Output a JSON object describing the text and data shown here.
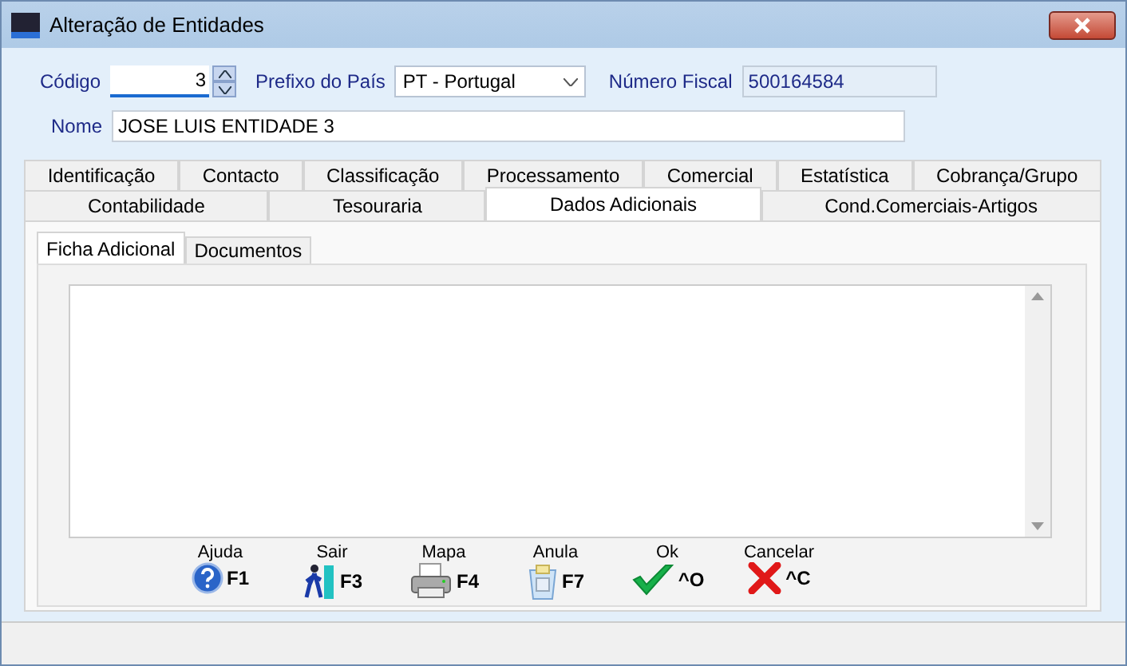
{
  "window": {
    "title": "Alteração de Entidades"
  },
  "form": {
    "codigo": {
      "label": "Código",
      "value": "3"
    },
    "prefixo": {
      "label": "Prefixo do País",
      "value": "PT - Portugal"
    },
    "nif": {
      "label": "Número Fiscal",
      "value": "500164584"
    },
    "nome": {
      "label": "Nome",
      "value": "JOSE LUIS ENTIDADE 3"
    }
  },
  "tab_rows": [
    [
      {
        "label": "Identificação",
        "selected": false
      },
      {
        "label": "Contacto",
        "selected": false
      },
      {
        "label": "Classificação",
        "selected": false
      },
      {
        "label": "Processamento",
        "selected": false
      },
      {
        "label": "Comercial",
        "selected": false
      },
      {
        "label": "Estatística",
        "selected": false
      },
      {
        "label": "Cobrança/Grupo",
        "selected": false
      }
    ],
    [
      {
        "label": "Contabilidade",
        "selected": false
      },
      {
        "label": "Tesouraria",
        "selected": false
      },
      {
        "label": "Dados Adicionais",
        "selected": true
      },
      {
        "label": "Cond.Comerciais-Artigos",
        "selected": false
      }
    ]
  ],
  "sub_tabs": [
    {
      "label": "Ficha Adicional",
      "selected": true
    },
    {
      "label": "Documentos",
      "selected": false
    }
  ],
  "buttons": [
    {
      "label": "Ajuda",
      "key": "F1"
    },
    {
      "label": "Sair",
      "key": "F3"
    },
    {
      "label": "Mapa",
      "key": "F4"
    },
    {
      "label": "Anula",
      "key": "F7"
    },
    {
      "label": "Ok",
      "key": "^O"
    },
    {
      "label": "Cancelar",
      "key": "^C"
    }
  ]
}
